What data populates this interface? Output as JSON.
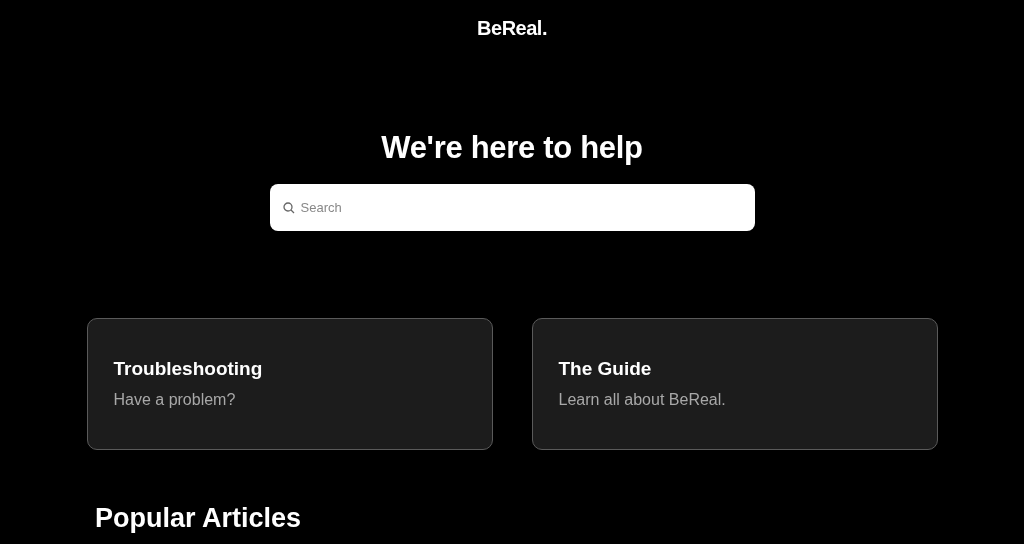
{
  "header": {
    "logo": "BeReal."
  },
  "hero": {
    "title": "We're here to help",
    "search": {
      "placeholder": "Search"
    }
  },
  "cards": [
    {
      "title": "Troubleshooting",
      "subtitle": "Have a problem?"
    },
    {
      "title": "The Guide",
      "subtitle": "Learn all about BeReal."
    }
  ],
  "section": {
    "title": "Popular Articles"
  }
}
